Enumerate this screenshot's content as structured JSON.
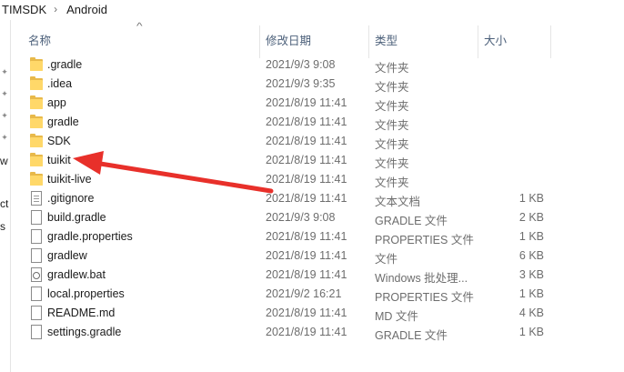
{
  "breadcrumb": [
    "TIMSDK",
    "Android"
  ],
  "breadcrumb_sep": "›",
  "nav_pane": {
    "pins": [
      "✦",
      "✦",
      "✦",
      "✦"
    ],
    "fragments": [
      "w",
      "ct",
      "s"
    ]
  },
  "columns": {
    "name": "名称",
    "date": "修改日期",
    "type": "类型",
    "size": "大小"
  },
  "sort_indicator": "^",
  "files": [
    {
      "name": ".gradle",
      "date": "2021/9/3 9:08",
      "type": "文件夹",
      "size": "",
      "icon": "folder-icon"
    },
    {
      "name": ".idea",
      "date": "2021/9/3 9:35",
      "type": "文件夹",
      "size": "",
      "icon": "folder-icon"
    },
    {
      "name": "app",
      "date": "2021/8/19 11:41",
      "type": "文件夹",
      "size": "",
      "icon": "folder-icon"
    },
    {
      "name": "gradle",
      "date": "2021/8/19 11:41",
      "type": "文件夹",
      "size": "",
      "icon": "folder-icon"
    },
    {
      "name": "SDK",
      "date": "2021/8/19 11:41",
      "type": "文件夹",
      "size": "",
      "icon": "folder-icon"
    },
    {
      "name": "tuikit",
      "date": "2021/8/19 11:41",
      "type": "文件夹",
      "size": "",
      "icon": "folder-icon"
    },
    {
      "name": "tuikit-live",
      "date": "2021/8/19 11:41",
      "type": "文件夹",
      "size": "",
      "icon": "folder-icon"
    },
    {
      "name": ".gitignore",
      "date": "2021/8/19 11:41",
      "type": "文本文档",
      "size": "1 KB",
      "icon": "text-file-icon"
    },
    {
      "name": "build.gradle",
      "date": "2021/9/3 9:08",
      "type": "GRADLE 文件",
      "size": "2 KB",
      "icon": "file-icon"
    },
    {
      "name": "gradle.properties",
      "date": "2021/8/19 11:41",
      "type": "PROPERTIES 文件",
      "size": "1 KB",
      "icon": "file-icon"
    },
    {
      "name": "gradlew",
      "date": "2021/8/19 11:41",
      "type": "文件",
      "size": "6 KB",
      "icon": "file-icon"
    },
    {
      "name": "gradlew.bat",
      "date": "2021/8/19 11:41",
      "type": "Windows 批处理...",
      "size": "3 KB",
      "icon": "batch-file-icon"
    },
    {
      "name": "local.properties",
      "date": "2021/9/2 16:21",
      "type": "PROPERTIES 文件",
      "size": "1 KB",
      "icon": "file-icon"
    },
    {
      "name": "README.md",
      "date": "2021/8/19 11:41",
      "type": "MD 文件",
      "size": "4 KB",
      "icon": "file-icon"
    },
    {
      "name": "settings.gradle",
      "date": "2021/8/19 11:41",
      "type": "GRADLE 文件",
      "size": "1 KB",
      "icon": "file-icon"
    }
  ],
  "colors": {
    "folder_front": "#ffd869",
    "folder_back": "#e8b94a",
    "arrow": "#e8302a",
    "header_text": "#4c607a",
    "meta_text": "#6d6d6d"
  }
}
